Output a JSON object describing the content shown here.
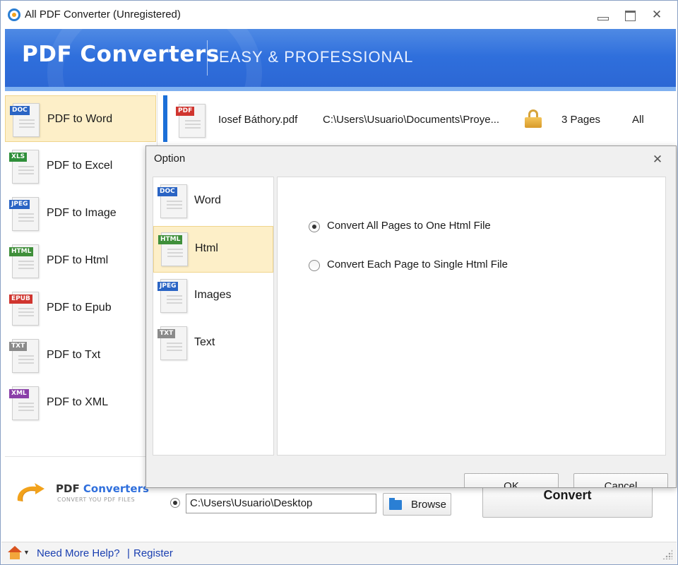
{
  "window": {
    "title": "All PDF Converter (Unregistered)",
    "controls": {
      "minimize": "",
      "maximize": "",
      "close": "✕"
    }
  },
  "banner": {
    "title": "PDF Converters",
    "subtitle": "EASY & PROFESSIONAL",
    "colors": {
      "background": "#2f6fdc",
      "text": "#ffffff"
    }
  },
  "sidebar": {
    "items": [
      {
        "label": "PDF to Word",
        "tag": "DOC",
        "tag_color": "#2a64c4",
        "icon": "doc-file-icon",
        "selected": true
      },
      {
        "label": "PDF to Excel",
        "tag": "XLS",
        "tag_color": "#2f8f3a",
        "icon": "xls-file-icon",
        "selected": false
      },
      {
        "label": "PDF to Image",
        "tag": "JPEG",
        "tag_color": "#2a64c4",
        "icon": "jpeg-file-icon",
        "selected": false
      },
      {
        "label": "PDF to Html",
        "tag": "HTML",
        "tag_color": "#3f8f3a",
        "icon": "html-file-icon",
        "selected": false
      },
      {
        "label": "PDF to Epub",
        "tag": "EPUB",
        "tag_color": "#d0352f",
        "icon": "epub-file-icon",
        "selected": false
      },
      {
        "label": "PDF to Txt",
        "tag": "TXT",
        "tag_color": "#8a8a8a",
        "icon": "txt-file-icon",
        "selected": false
      },
      {
        "label": "PDF to XML",
        "tag": "XML",
        "tag_color": "#8a3fa8",
        "icon": "xml-file-icon",
        "selected": false
      }
    ]
  },
  "file": {
    "tag": "PDF",
    "tag_color": "#d0352f",
    "name": "Iosef Báthory.pdf",
    "path": "C:\\Users\\Usuario\\Documents\\Proye...",
    "pages": "3 Pages",
    "range": "All",
    "lock_icon": "unlocked-padlock-icon"
  },
  "output": {
    "path": "C:\\Users\\Usuario\\Desktop",
    "browse_label": "Browse",
    "convert_label": "Convert"
  },
  "logo": {
    "text_a": "PDF ",
    "text_b": "Converters",
    "tagline": "CONVERT YOU PDF FILES"
  },
  "status": {
    "help": "Need More Help?",
    "separator": "|",
    "register": "Register",
    "link_color": "#1a3fb0"
  },
  "dialog": {
    "title": "Option",
    "close": "✕",
    "formats": [
      {
        "label": "Word",
        "tag": "DOC",
        "tag_color": "#2a64c4",
        "selected": false
      },
      {
        "label": "Html",
        "tag": "HTML",
        "tag_color": "#3f8f3a",
        "selected": true
      },
      {
        "label": "Images",
        "tag": "JPEG",
        "tag_color": "#2a64c4",
        "selected": false
      },
      {
        "label": "Text",
        "tag": "TXT",
        "tag_color": "#8a8a8a",
        "selected": false
      }
    ],
    "options": [
      {
        "label": "Convert All Pages to One Html File",
        "checked": true
      },
      {
        "label": "Convert Each Page to Single Html File",
        "checked": false
      }
    ],
    "ok_label": "OK",
    "cancel_label": "Cancel"
  }
}
